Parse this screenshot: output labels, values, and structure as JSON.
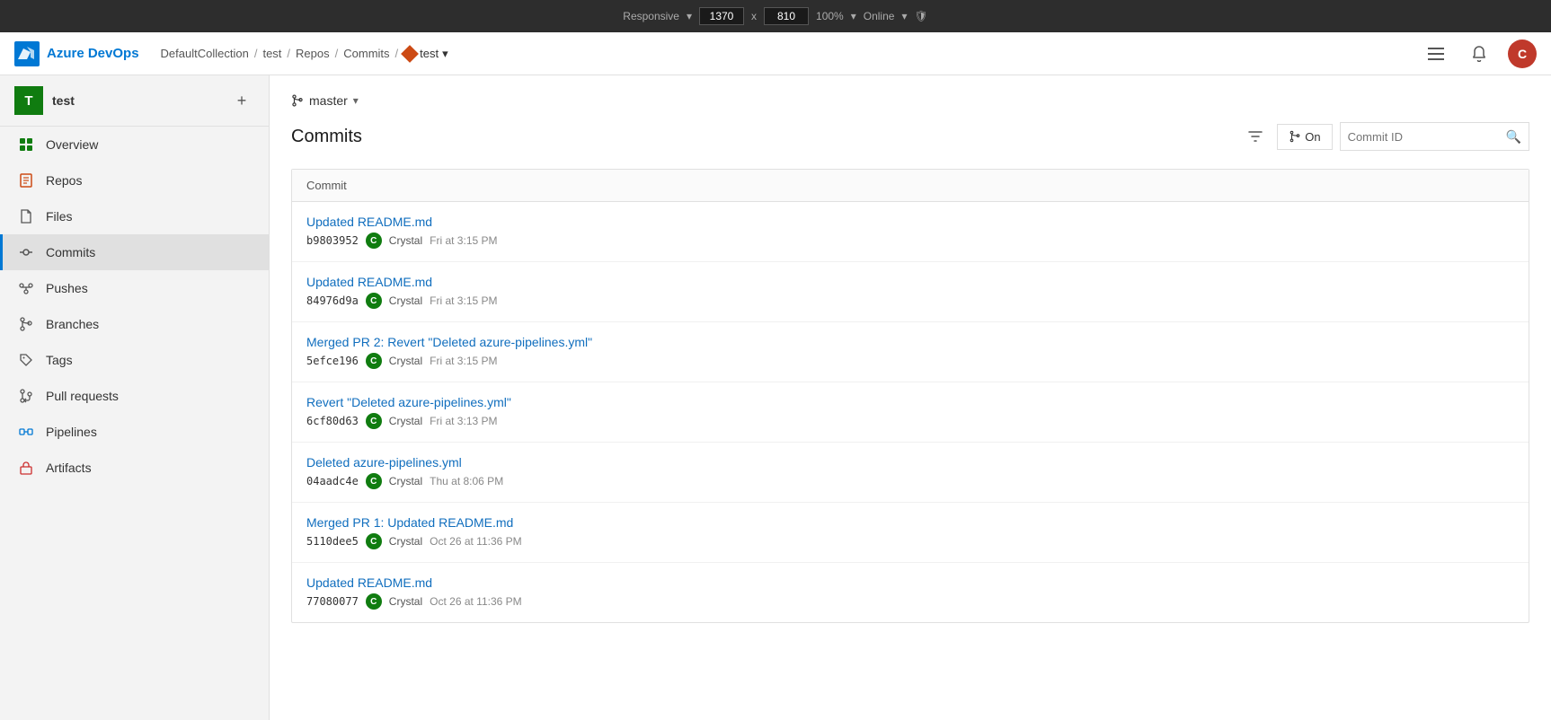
{
  "browser": {
    "responsive_label": "Responsive",
    "width": "1370",
    "x_separator": "x",
    "height": "810",
    "zoom": "100%",
    "online": "Online"
  },
  "topnav": {
    "logo_text": "Azure DevOps",
    "breadcrumbs": [
      {
        "label": "DefaultCollection",
        "link": true
      },
      {
        "label": "test",
        "link": true
      },
      {
        "label": "Repos",
        "link": true
      },
      {
        "label": "Commits",
        "link": true
      },
      {
        "label": "test",
        "link": false,
        "has_icon": true
      }
    ],
    "user_initial": "C"
  },
  "sidebar": {
    "project_initial": "T",
    "project_name": "test",
    "add_label": "+",
    "nav_items": [
      {
        "id": "overview",
        "label": "Overview",
        "icon": "overview",
        "active": false
      },
      {
        "id": "repos",
        "label": "Repos",
        "icon": "repos",
        "active": false
      },
      {
        "id": "files",
        "label": "Files",
        "icon": "files",
        "active": false
      },
      {
        "id": "commits",
        "label": "Commits",
        "icon": "commits",
        "active": true
      },
      {
        "id": "pushes",
        "label": "Pushes",
        "icon": "pushes",
        "active": false
      },
      {
        "id": "branches",
        "label": "Branches",
        "icon": "branches",
        "active": false
      },
      {
        "id": "tags",
        "label": "Tags",
        "icon": "tags",
        "active": false
      },
      {
        "id": "pull-requests",
        "label": "Pull requests",
        "icon": "pullreqs",
        "active": false
      },
      {
        "id": "pipelines",
        "label": "Pipelines",
        "icon": "pipelines",
        "active": false
      },
      {
        "id": "artifacts",
        "label": "Artifacts",
        "icon": "artifacts",
        "active": false
      }
    ]
  },
  "content": {
    "branch": {
      "name": "master",
      "icon": "branch"
    },
    "page_title": "Commits",
    "graph_btn_label": "On",
    "commit_id_placeholder": "Commit ID",
    "table_column": "Commit",
    "commits": [
      {
        "message": "Updated README.md",
        "hash": "b9803952",
        "author": "Crystal",
        "author_initial": "C",
        "time": "Fri at 3:15 PM"
      },
      {
        "message": "Updated README.md",
        "hash": "84976d9a",
        "author": "Crystal",
        "author_initial": "C",
        "time": "Fri at 3:15 PM"
      },
      {
        "message": "Merged PR 2: Revert \"Deleted azure-pipelines.yml\"",
        "hash": "5efce196",
        "author": "Crystal",
        "author_initial": "C",
        "time": "Fri at 3:15 PM"
      },
      {
        "message": "Revert \"Deleted azure-pipelines.yml\"",
        "hash": "6cf80d63",
        "author": "Crystal",
        "author_initial": "C",
        "time": "Fri at 3:13 PM"
      },
      {
        "message": "Deleted azure-pipelines.yml",
        "hash": "04aadc4e",
        "author": "Crystal",
        "author_initial": "C",
        "time": "Thu at 8:06 PM"
      },
      {
        "message": "Merged PR 1: Updated README.md",
        "hash": "5110dee5",
        "author": "Crystal",
        "author_initial": "C",
        "time": "Oct 26 at 11:36 PM"
      },
      {
        "message": "Updated README.md",
        "hash": "77080077",
        "author": "Crystal",
        "author_initial": "C",
        "time": "Oct 26 at 11:36 PM"
      }
    ]
  }
}
